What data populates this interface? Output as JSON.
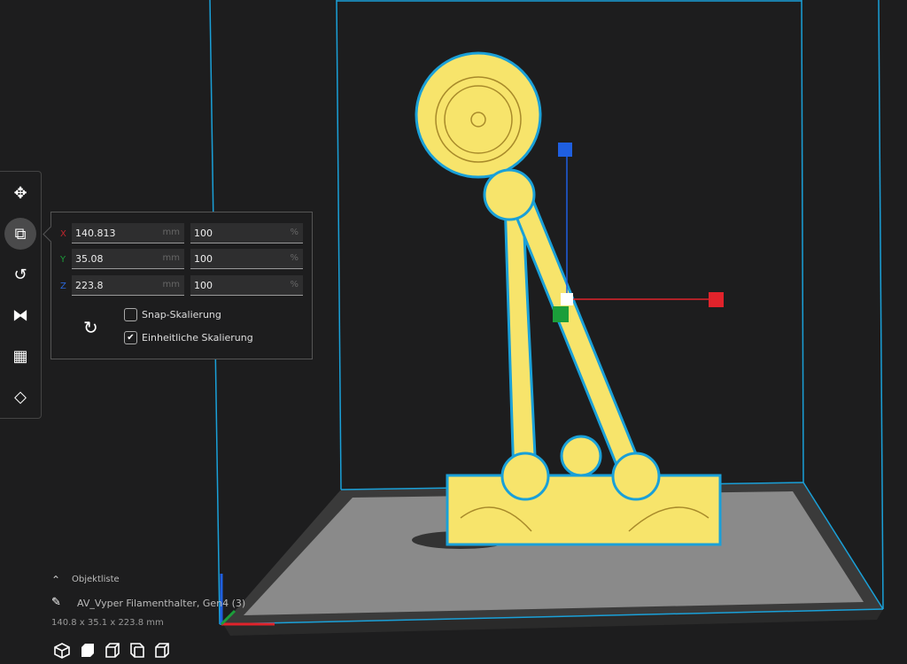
{
  "toolbar": {
    "tools": [
      {
        "name": "move"
      },
      {
        "name": "scale",
        "active": true
      },
      {
        "name": "rotate"
      },
      {
        "name": "mirror"
      },
      {
        "name": "per-model-settings"
      },
      {
        "name": "support-blocker"
      }
    ]
  },
  "scale_panel": {
    "x": {
      "label": "X",
      "mm": "140.813",
      "unit_mm": "mm",
      "percent": "100",
      "unit_pct": "%"
    },
    "y": {
      "label": "Y",
      "mm": "35.08",
      "unit_mm": "mm",
      "percent": "100",
      "unit_pct": "%"
    },
    "z": {
      "label": "Z",
      "mm": "223.8",
      "unit_mm": "mm",
      "percent": "100",
      "unit_pct": "%"
    },
    "snap_label": "Snap-Skalierung",
    "snap_checked": false,
    "uniform_label": "Einheitliche Skalierung",
    "uniform_checked": true,
    "check_mark": "✔"
  },
  "object_list": {
    "title": "Objektliste",
    "object_name": "AV_Vyper Filamenthalter, Gen4 (3)",
    "dimensions": "140.8 x 35.1 x 223.8 mm"
  },
  "colors": {
    "accent": "#00a6e0",
    "model": "#f7e46b",
    "x_axis": "#e0232b",
    "y_axis": "#1b9e3a",
    "z_axis": "#1f5fe0"
  }
}
